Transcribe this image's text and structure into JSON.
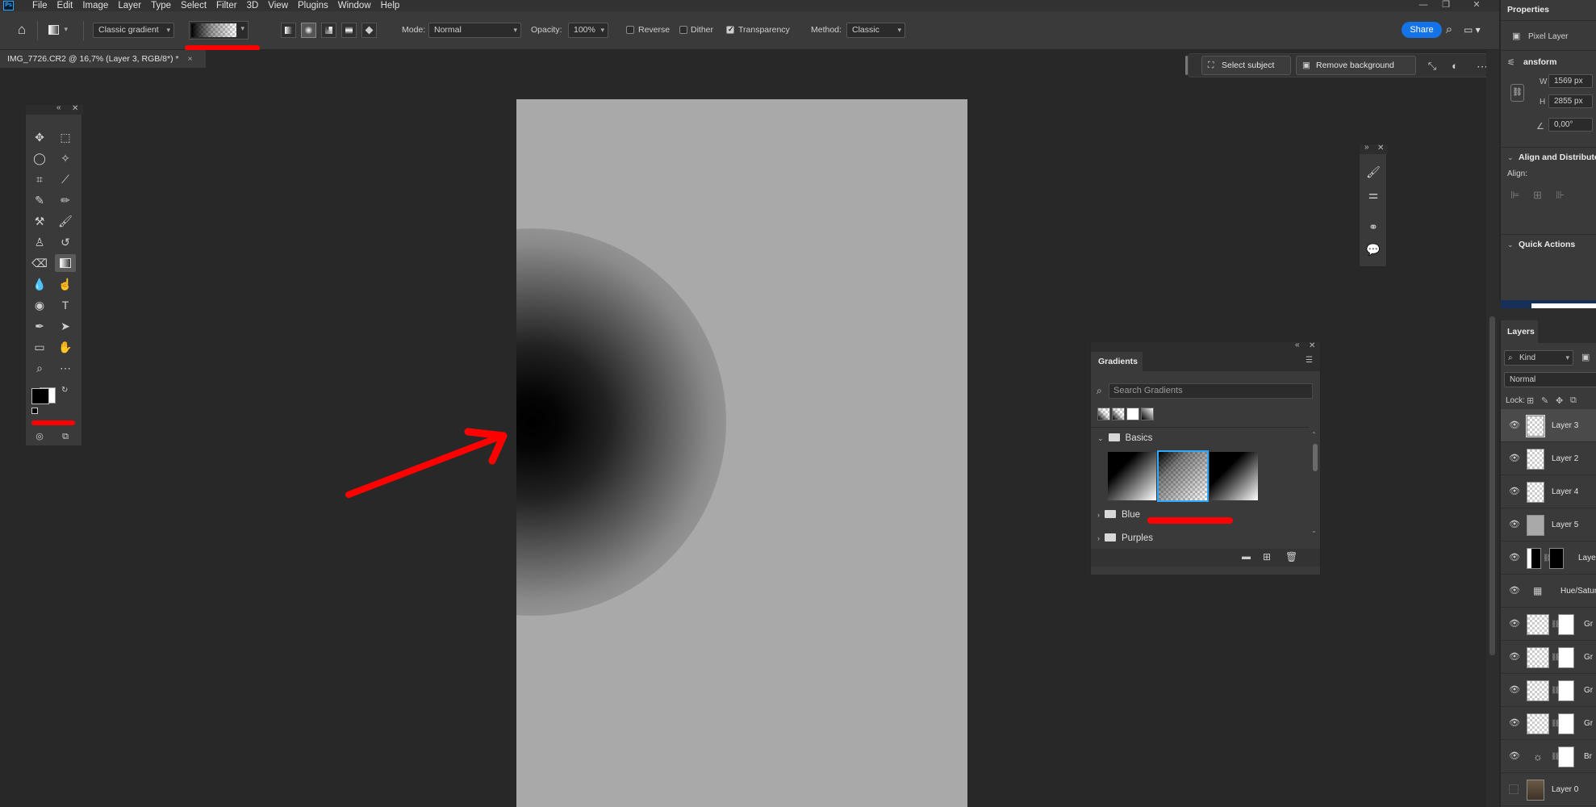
{
  "app": {
    "logo": "Ps",
    "colors": {
      "accent": "#1473e6",
      "annotation": "#ff0000",
      "selection": "#31a8ff"
    }
  },
  "menubar": {
    "items": [
      "File",
      "Edit",
      "Image",
      "Layer",
      "Type",
      "Select",
      "Filter",
      "3D",
      "View",
      "Plugins",
      "Window",
      "Help"
    ]
  },
  "options": {
    "gradient_type": "Classic gradient",
    "mode_label": "Mode:",
    "mode_value": "Normal",
    "opacity_label": "Opacity:",
    "opacity_value": "100%",
    "reverse_label": "Reverse",
    "dither_label": "Dither",
    "transparency_label": "Transparency",
    "method_label": "Method:",
    "method_value": "Classic",
    "share_label": "Share"
  },
  "document": {
    "tab_title": "IMG_7726.CR2 @ 16,7% (Layer 3, RGB/8*) *"
  },
  "context_bar": {
    "select_subject": "Select subject",
    "remove_background": "Remove background"
  },
  "gradients_panel": {
    "title": "Gradients",
    "search_placeholder": "Search Gradients",
    "folders": [
      "Basics",
      "Blue",
      "Purples"
    ]
  },
  "properties": {
    "title": "Properties",
    "layer_kind": "Pixel Layer",
    "transform_label": "ansform",
    "w_label": "W",
    "w_value": "1569 px",
    "h_label": "H",
    "h_value": "2855 px",
    "angle_value": "0,00°",
    "align_section": "Align and Distribute",
    "align_label": "Align:",
    "quick_actions": "Quick Actions"
  },
  "layers": {
    "title": "Layers",
    "filter_kind": "Kind",
    "blend_mode": "Normal",
    "lock_label": "Lock:",
    "items": [
      "Layer 3",
      "Layer 2",
      "Layer 4",
      "Layer 5",
      "Laye",
      "Hue/Satur",
      "Gr",
      "Gr",
      "Gr",
      "Gr",
      "Br",
      "Layer 0"
    ]
  }
}
